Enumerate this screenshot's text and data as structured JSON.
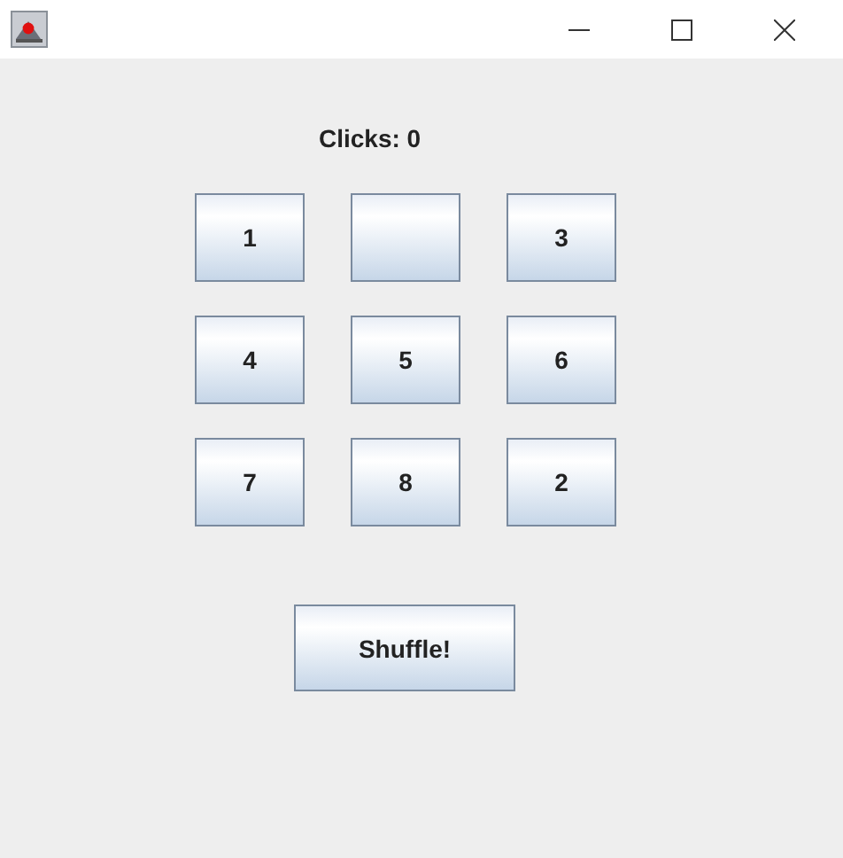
{
  "clicks_label": "Clicks: 0",
  "tiles": [
    {
      "kind": "number",
      "label": "1"
    },
    {
      "kind": "blank"
    },
    {
      "kind": "number",
      "label": "3"
    },
    {
      "kind": "number",
      "label": "4"
    },
    {
      "kind": "number",
      "label": "5"
    },
    {
      "kind": "number",
      "label": "6"
    },
    {
      "kind": "number",
      "label": "7"
    },
    {
      "kind": "number",
      "label": "8"
    },
    {
      "kind": "number",
      "label": "2"
    }
  ],
  "shuffle_button": "Shuffle!"
}
